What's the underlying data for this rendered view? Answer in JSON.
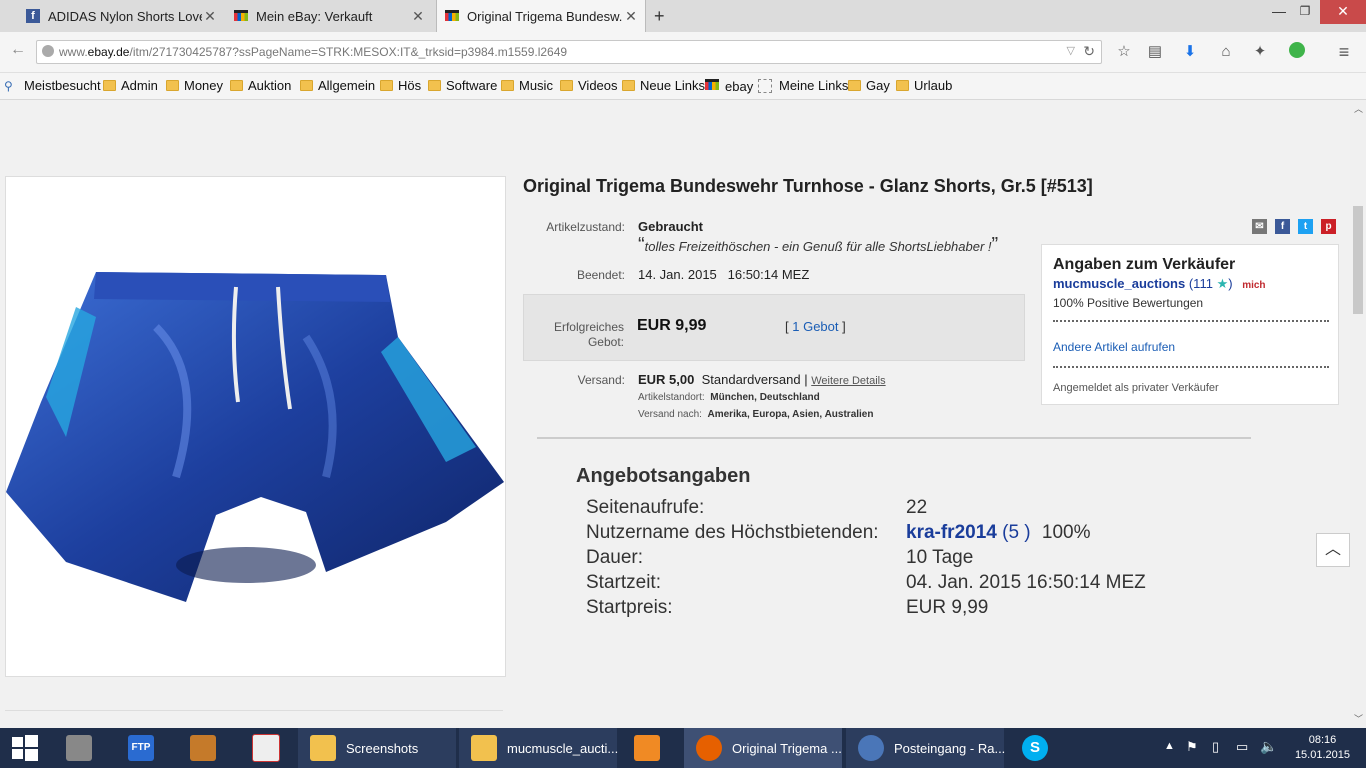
{
  "tabs": [
    {
      "title": "ADIDAS Nylon Shorts Lovers",
      "icon": "facebook-icon"
    },
    {
      "title": "Mein eBay: Verkauft",
      "icon": "ebay-icon"
    },
    {
      "title": "Original Trigema Bundesw...",
      "icon": "ebay-icon"
    }
  ],
  "url": {
    "prefix": "www.",
    "domain": "ebay.de",
    "path": "/itm/271730425787?ssPageName=STRK:MESOX:IT&_trksid=p3984.m1559.l2649"
  },
  "bookmarks": [
    "Meistbesucht",
    "Admin",
    "Money",
    "Auktion",
    "Allgemein",
    "Hös",
    "Software",
    "Music",
    "Videos",
    "Neue Links",
    "ebay",
    "Meine Links",
    "Gay",
    "Urlaub"
  ],
  "item": {
    "title": "Original Trigema Bundeswehr Turnhose - Glanz Shorts, Gr.5 [#513]",
    "condition_label": "Artikelzustand:",
    "condition": "Gebraucht",
    "quote": "tolles Freizeithöschen - ein Genuß für alle ShortsLiebhaber !",
    "ended_label": "Beendet:",
    "ended": "14. Jan. 2015   16:50:14 MEZ",
    "bid_label_1": "Erfolgreiches",
    "bid_label_2": "Gebot:",
    "price": "EUR 9,99",
    "bids": "1 Gebot",
    "shipping_label": "Versand:",
    "shipping_price": "EUR 5,00",
    "shipping_type": "Standardversand |",
    "shipping_details": "Weitere Details",
    "location_label": "Artikelstandort:",
    "location": "München, Deutschland",
    "shipto_label": "Versand nach:",
    "shipto": "Amerika, Europa, Asien, Australien"
  },
  "seller": {
    "heading": "Angaben zum Verkäufer",
    "name": "mucmuscle_auctions",
    "score": "(111",
    "score_close": ")",
    "me_badge": "mich",
    "positive": "100% Positive Bewertungen",
    "other_items": "Andere Artikel aufrufen",
    "private": "Angemeldet als privater Verkäufer"
  },
  "offer": {
    "heading": "Angebotsangaben",
    "rows": [
      {
        "label": "Seitenaufrufe:",
        "value": "22"
      },
      {
        "label": "Nutzername des Höchstbietenden:",
        "value": ""
      },
      {
        "label": "Dauer:",
        "value": "10 Tage"
      },
      {
        "label": "Startzeit:",
        "value": "04. Jan. 2015 16:50:14 MEZ"
      },
      {
        "label": "Startpreis:",
        "value": "EUR 9,99"
      }
    ],
    "bidder_name": "kra-fr2014",
    "bidder_score": "(5 )",
    "bidder_pct": "100%"
  },
  "taskbar": {
    "items": [
      "Screenshots",
      "mucmuscle_aucti...",
      "Original Trigema ...",
      "Posteingang - Ra..."
    ],
    "time": "08:16",
    "date": "15.01.2015"
  },
  "colors": {
    "accent_link": "#1a3d9b",
    "ebay_red": "#e53238"
  }
}
